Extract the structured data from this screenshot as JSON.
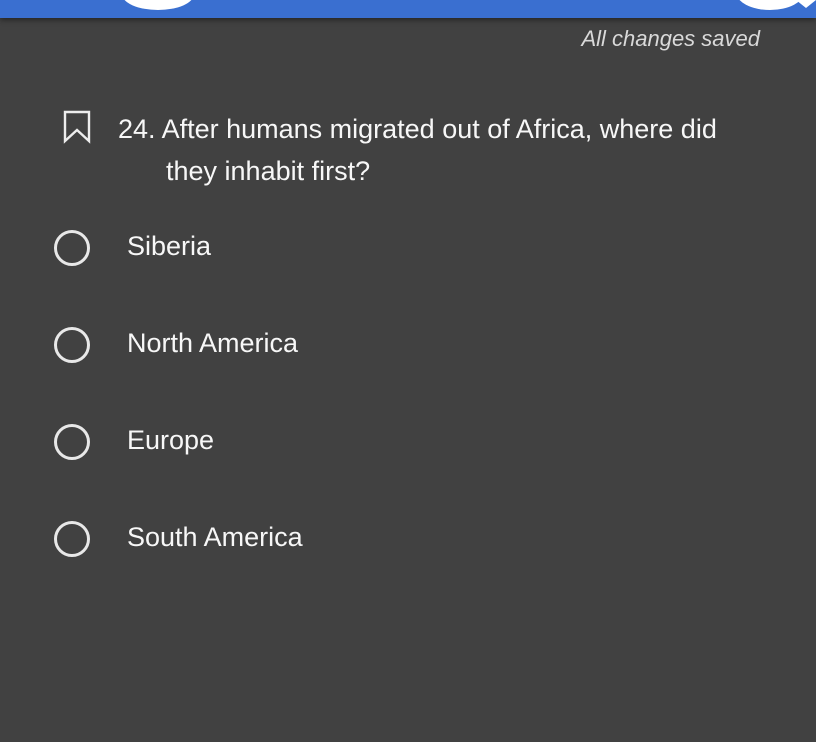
{
  "header": {
    "save_status": "All changes saved"
  },
  "question": {
    "number": "24.",
    "text_line1": "After humans migrated out of Africa, where did",
    "text_line2": "they inhabit first?",
    "bookmark_icon": "bookmark-outline-icon"
  },
  "options": [
    {
      "label": "Siberia",
      "selected": false
    },
    {
      "label": "North America",
      "selected": false
    },
    {
      "label": "Europe",
      "selected": false
    },
    {
      "label": "South America",
      "selected": false
    }
  ],
  "colors": {
    "background": "#414141",
    "topbar": "#3a6fd0",
    "text": "#f7f7f7"
  }
}
